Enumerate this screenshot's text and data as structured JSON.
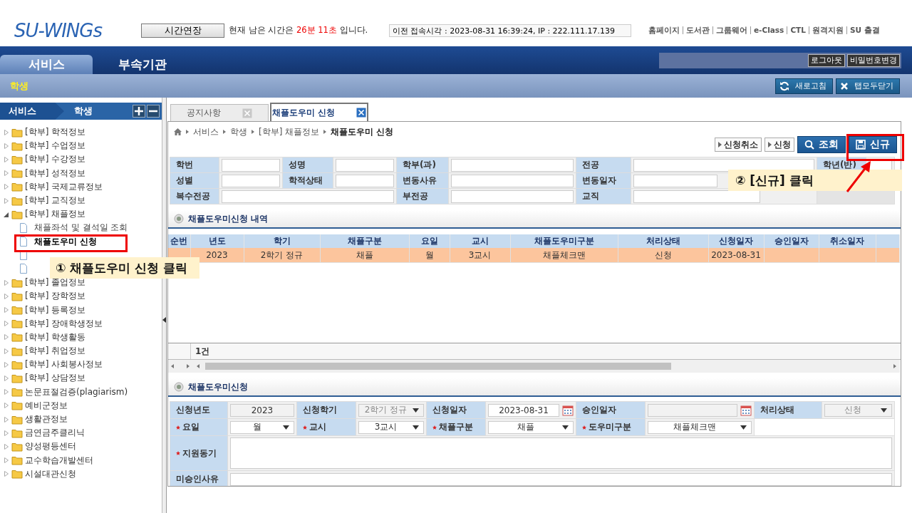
{
  "header": {
    "logo": "SU-WINGs",
    "extend_button": "시간연장",
    "notice_before": "현재 남은 시간은",
    "remaining": "26분 11초",
    "notice_after": "입니다.",
    "last_access": "이전 접속시각 : 2023-08-31 16:39:24,  IP : 222.111.17.139",
    "links": [
      "홈페이지",
      "도서관",
      "그룹웨어",
      "e-Class",
      "CTL",
      "원격지원",
      "SU 출결"
    ]
  },
  "nav": {
    "tabs": [
      {
        "label": "서비스",
        "selected": true
      },
      {
        "label": "부속기관",
        "selected": false
      }
    ],
    "buttons": [
      "로그아웃",
      "비밀번호변경"
    ]
  },
  "subbar": {
    "title": "학생",
    "buttons": [
      {
        "label": "새로고침",
        "kind": "refresh"
      },
      {
        "label": "탭모두닫기",
        "kind": "close"
      }
    ]
  },
  "sidebar": {
    "crumbs": [
      "서비스",
      "학생"
    ],
    "tree": [
      {
        "label": "[학부] 학적정보",
        "expanded": false
      },
      {
        "label": "[학부] 수업정보",
        "expanded": false
      },
      {
        "label": "[학부] 수강정보",
        "expanded": false
      },
      {
        "label": "[학부] 성적정보",
        "expanded": false
      },
      {
        "label": "[학부] 국제교류정보",
        "expanded": false
      },
      {
        "label": "[학부] 교직정보",
        "expanded": false
      },
      {
        "label": "[학부] 채플정보",
        "expanded": true,
        "children": [
          {
            "kind": "page",
            "label": "채플좌석 및 결석일 조회",
            "selected": false
          },
          {
            "kind": "page",
            "label": "채플도우미 신청",
            "selected": true
          },
          {
            "kind": "covered"
          },
          {
            "kind": "covered"
          }
        ]
      },
      {
        "label": "[학부] 졸업정보",
        "expanded": false
      },
      {
        "label": "[학부] 장학정보",
        "expanded": false
      },
      {
        "label": "[학부] 등록정보",
        "expanded": false
      },
      {
        "label": "[학부] 장애학생정보",
        "expanded": false
      },
      {
        "label": "[학부] 학생활동",
        "expanded": false
      },
      {
        "label": "[학부] 취업정보",
        "expanded": false
      },
      {
        "label": "[학부] 사회봉사정보",
        "expanded": false
      },
      {
        "label": "[학부] 상담정보",
        "expanded": false
      },
      {
        "label": "논문표절검증(plagiarism)",
        "expanded": false
      },
      {
        "label": "예비군정보",
        "expanded": false
      },
      {
        "label": "생활관정보",
        "expanded": false
      },
      {
        "label": "금연금주클리닉",
        "expanded": false
      },
      {
        "label": "양성평등센터",
        "expanded": false
      },
      {
        "label": "교수학습개발센터",
        "expanded": false
      },
      {
        "label": "시설대관신청",
        "expanded": false
      }
    ]
  },
  "tabs": [
    {
      "label": "공지사항",
      "selected": false
    },
    {
      "label": "채플도우미 신청",
      "selected": true
    }
  ],
  "breadcrumb": [
    "서비스",
    "학생",
    "[학부] 채플정보",
    "채플도우미 신청"
  ],
  "actions": [
    {
      "label": "신청취소",
      "kind": "plain"
    },
    {
      "label": "신청",
      "kind": "plain"
    },
    {
      "label": "조회",
      "kind": "search"
    },
    {
      "label": "신규",
      "kind": "new"
    }
  ],
  "student_info": {
    "rows": [
      {
        "fields": [
          {
            "label": "학번"
          },
          {
            "label": "성명"
          },
          {
            "label": "학부(과)"
          },
          {
            "label": "전공"
          },
          {
            "label": "학년(반)"
          }
        ]
      },
      {
        "fields": [
          {
            "label": "성별"
          },
          {
            "label": "학적상태"
          },
          {
            "label": "변동사유"
          },
          {
            "label": "변동일자"
          }
        ]
      },
      {
        "fields": [
          {
            "label": "복수전공"
          },
          {
            "label": "부전공"
          },
          {
            "label": "교직"
          }
        ]
      }
    ]
  },
  "history": {
    "title": "채플도우미신청 내역",
    "columns": [
      "순번",
      "년도",
      "학기",
      "채플구분",
      "요일",
      "교시",
      "채플도우미구분",
      "처리상태",
      "신청일자",
      "승인일자",
      "취소일자"
    ],
    "rows": [
      {
        "selected": true,
        "cells": [
          "",
          "2023",
          "2학기 정규",
          "채플",
          "월",
          "3교시",
          "채플체크맨",
          "신청",
          "2023-08-31",
          "",
          ""
        ]
      }
    ],
    "count": "1건"
  },
  "form": {
    "title": "채플도우미신청",
    "rows": [
      [
        {
          "label": "신청년도",
          "required": false,
          "kind": "text",
          "value": "2023",
          "disabled": true
        },
        {
          "label": "신청학기",
          "required": false,
          "kind": "select",
          "value": "2학기 정규",
          "disabled": true
        },
        {
          "label": "신청일자",
          "required": false,
          "kind": "date",
          "value": "2023-08-31",
          "disabled": false
        },
        {
          "label": "승인일자",
          "required": false,
          "kind": "date",
          "disabled": true
        },
        {
          "label": "처리상태",
          "required": false,
          "kind": "select",
          "value": "신청",
          "disabled": true
        }
      ],
      [
        {
          "label": "요일",
          "required": true,
          "kind": "select",
          "value": "월",
          "disabled": false
        },
        {
          "label": "교시",
          "required": true,
          "kind": "select",
          "value": "3교시",
          "disabled": false
        },
        {
          "label": "채플구분",
          "required": true,
          "kind": "select",
          "value": "채플",
          "disabled": false
        },
        {
          "label": "도우미구분",
          "required": true,
          "kind": "select",
          "value": "채플체크맨",
          "disabled": false
        }
      ],
      [
        {
          "label": "지원동기",
          "required": true,
          "kind": "textarea",
          "disabled": false
        }
      ],
      [
        {
          "label": "미승인사유",
          "required": false,
          "kind": "text",
          "disabled": false
        }
      ]
    ]
  },
  "annotations": [
    {
      "text": "① 채플도우미 신청 클릭"
    },
    {
      "text": "② [신규] 클릭"
    }
  ]
}
